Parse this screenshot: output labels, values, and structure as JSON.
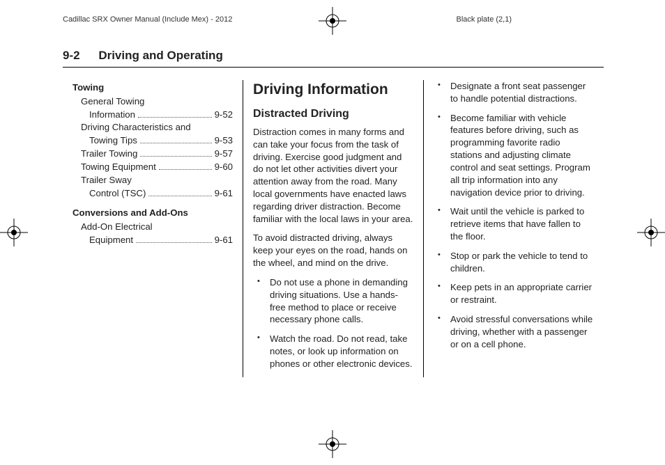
{
  "meta": {
    "doc_title": "Cadillac SRX Owner Manual (Include Mex) - 2012",
    "plate": "Black plate (2,1)"
  },
  "header": {
    "page_number": "9-2",
    "chapter": "Driving and Operating"
  },
  "col1": {
    "sections": [
      {
        "heading": "Towing",
        "items": [
          {
            "label_a": "General Towing",
            "label_b": "Information",
            "page": "9-52"
          },
          {
            "label_a": "Driving Characteristics and",
            "label_b": "Towing Tips",
            "page": "9-53"
          },
          {
            "label_a": "Trailer Towing",
            "label_b": "",
            "page": "9-57"
          },
          {
            "label_a": "Towing Equipment",
            "label_b": "",
            "page": "9-60"
          },
          {
            "label_a": "Trailer Sway",
            "label_b": "Control (TSC)",
            "page": "9-61"
          }
        ]
      },
      {
        "heading": "Conversions and Add-Ons",
        "items": [
          {
            "label_a": "Add-On Electrical",
            "label_b": "Equipment",
            "page": "9-61"
          }
        ]
      }
    ]
  },
  "col2": {
    "title": "Driving Information",
    "subtitle": "Distracted Driving",
    "para1": "Distraction comes in many forms and can take your focus from the task of driving. Exercise good judgment and do not let other activities divert your attention away from the road. Many local governments have enacted laws regarding driver distraction. Become familiar with the local laws in your area.",
    "para2": "To avoid distracted driving, always keep your eyes on the road, hands on the wheel, and mind on the drive.",
    "bullets": [
      "Do not use a phone in demanding driving situations. Use a hands-free method to place or receive necessary phone calls.",
      "Watch the road. Do not read, take notes, or look up information on phones or other electronic devices."
    ]
  },
  "col3": {
    "bullets": [
      "Designate a front seat passenger to handle potential distractions.",
      "Become familiar with vehicle features before driving, such as programming favorite radio stations and adjusting climate control and seat settings. Program all trip information into any navigation device prior to driving.",
      "Wait until the vehicle is parked to retrieve items that have fallen to the floor.",
      "Stop or park the vehicle to tend to children.",
      "Keep pets in an appropriate carrier or restraint.",
      "Avoid stressful conversations while driving, whether with a passenger or on a cell phone."
    ]
  }
}
